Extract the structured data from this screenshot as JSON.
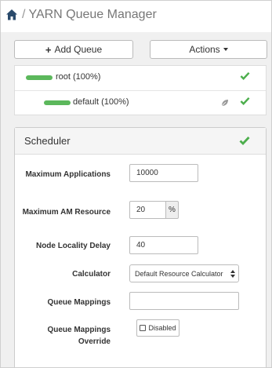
{
  "header": {
    "home_icon": "home-icon",
    "separator": "/",
    "title": "YARN Queue Manager"
  },
  "toolbar": {
    "add_queue_icon": "plus-icon",
    "add_queue_label": "Add Queue",
    "actions_label": "Actions"
  },
  "queues": [
    {
      "name": "root (100%)",
      "capacity_percent": 100,
      "status_icon": "check-icon"
    },
    {
      "name": "default (100%)",
      "capacity_percent": 100,
      "leaf_icon": "leaf-icon",
      "status_icon": "check-icon"
    }
  ],
  "scheduler": {
    "title": "Scheduler",
    "status_icon": "check-icon",
    "fields": {
      "max_applications": {
        "label": "Maximum Applications",
        "value": "10000"
      },
      "max_am_resource": {
        "label": "Maximum AM Resource",
        "value": "20",
        "unit": "%"
      },
      "node_locality_delay": {
        "label": "Node Locality Delay",
        "value": "40"
      },
      "calculator": {
        "label": "Calculator",
        "value": "Default Resource Calculator"
      },
      "queue_mappings": {
        "label": "Queue Mappings",
        "value": ""
      },
      "queue_mappings_override": {
        "label": "Queue Mappings Override",
        "value": "Disabled"
      }
    }
  },
  "colors": {
    "accent_green": "#5cb85c",
    "check_green": "#4cae4c"
  }
}
